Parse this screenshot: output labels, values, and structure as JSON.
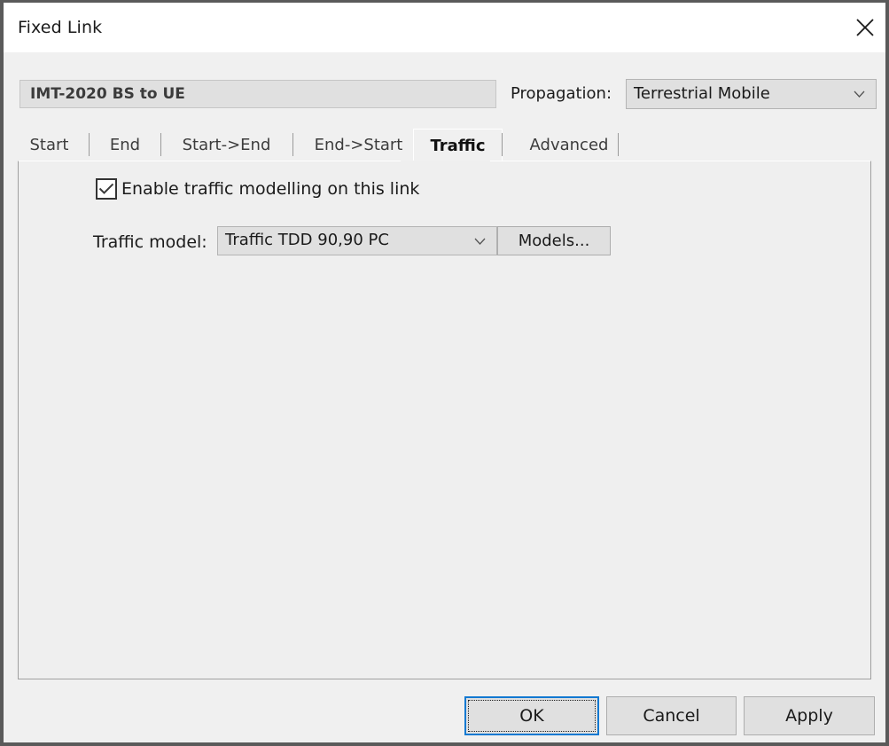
{
  "window": {
    "title": "Fixed Link",
    "close_icon": "close-icon"
  },
  "header": {
    "name_value": "IMT-2020 BS to UE",
    "propagation_label": "Propagation:",
    "propagation_value": "Terrestrial Mobile",
    "propagation_options": [
      "Terrestrial Mobile"
    ],
    "dropdown_icon": "chevron-down-icon"
  },
  "tabs": [
    {
      "label": "Start",
      "selected": false
    },
    {
      "label": "End",
      "selected": false
    },
    {
      "label": "Start->End",
      "selected": false
    },
    {
      "label": "End->Start",
      "selected": false
    },
    {
      "label": "Traffic",
      "selected": true
    },
    {
      "label": "Advanced",
      "selected": false
    }
  ],
  "traffic_tab": {
    "enable_checkbox_label": "Enable traffic modelling on this link",
    "enable_checkbox_checked": true,
    "check_icon": "check-icon",
    "model_label": "Traffic model:",
    "model_value": "Traffic TDD 90,90 PC",
    "model_options": [
      "Traffic TDD 90,90 PC"
    ],
    "models_button_label": "Models..."
  },
  "footer": {
    "ok_label": "OK",
    "cancel_label": "Cancel",
    "apply_label": "Apply"
  },
  "colors": {
    "window_border": "#5a5a5a",
    "dialog_bg": "#f0f0f0",
    "panel_bg": "#efefef",
    "control_bg": "#e0e0e0",
    "focus_accent": "#1279d1",
    "text": "#1a1a1a"
  }
}
